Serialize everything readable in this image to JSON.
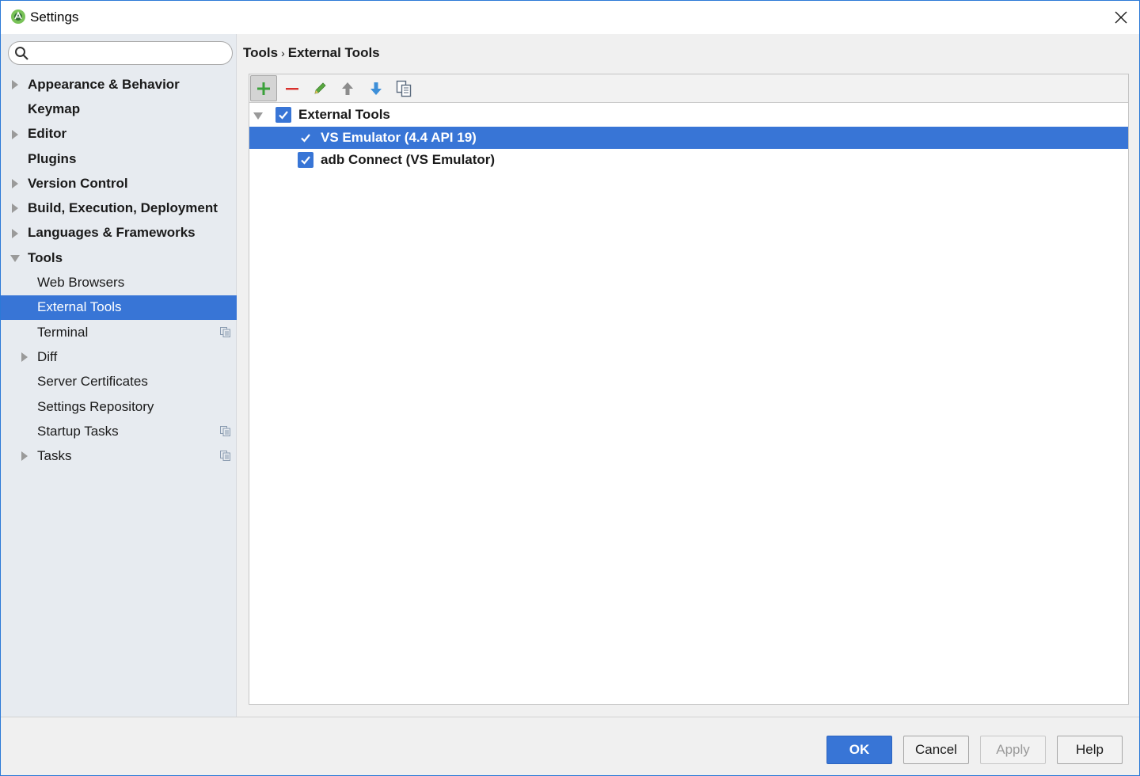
{
  "window": {
    "title": "Settings"
  },
  "search": {
    "placeholder": "",
    "value": ""
  },
  "sidebar": {
    "items": [
      {
        "label": "Appearance & Behavior",
        "expandable": true,
        "expanded": false,
        "bold": true
      },
      {
        "label": "Keymap",
        "expandable": false,
        "bold": true
      },
      {
        "label": "Editor",
        "expandable": true,
        "expanded": false,
        "bold": true
      },
      {
        "label": "Plugins",
        "expandable": false,
        "bold": true
      },
      {
        "label": "Version Control",
        "expandable": true,
        "expanded": false,
        "bold": true
      },
      {
        "label": "Build, Execution, Deployment",
        "expandable": true,
        "expanded": false,
        "bold": true
      },
      {
        "label": "Languages & Frameworks",
        "expandable": true,
        "expanded": false,
        "bold": true
      },
      {
        "label": "Tools",
        "expandable": true,
        "expanded": true,
        "bold": true
      },
      {
        "label": "Web Browsers",
        "expandable": false
      },
      {
        "label": "External Tools",
        "expandable": false,
        "selected": true
      },
      {
        "label": "Terminal",
        "expandable": false,
        "project_level": true
      },
      {
        "label": "Diff",
        "expandable": true,
        "expanded": false
      },
      {
        "label": "Server Certificates",
        "expandable": false
      },
      {
        "label": "Settings Repository",
        "expandable": false
      },
      {
        "label": "Startup Tasks",
        "expandable": false,
        "project_level": true
      },
      {
        "label": "Tasks",
        "expandable": true,
        "expanded": false,
        "project_level": true
      }
    ]
  },
  "breadcrumb": {
    "parent": "Tools",
    "separator": "›",
    "current": "External Tools"
  },
  "toolbar": {
    "buttons": [
      "add-icon",
      "remove-icon",
      "edit-icon",
      "move-up-icon",
      "move-down-icon",
      "copy-icon"
    ]
  },
  "tools_list": {
    "group": {
      "label": "External Tools",
      "checked": true,
      "expanded": true
    },
    "items": [
      {
        "label": "VS Emulator (4.4 API 19)",
        "checked": true,
        "selected": true
      },
      {
        "label": "adb Connect (VS Emulator)",
        "checked": true,
        "selected": false
      }
    ]
  },
  "footer": {
    "ok_label": "OK",
    "cancel_label": "Cancel",
    "apply_label": "Apply",
    "help_label": "Help"
  },
  "colors": {
    "selection": "#3875d6",
    "sidebar_bg": "#e7ebf0",
    "add_green": "#3aa13a",
    "remove_red": "#d9302c",
    "arrow_gray": "#8c8c8c",
    "arrow_blue": "#3d8fd8"
  }
}
